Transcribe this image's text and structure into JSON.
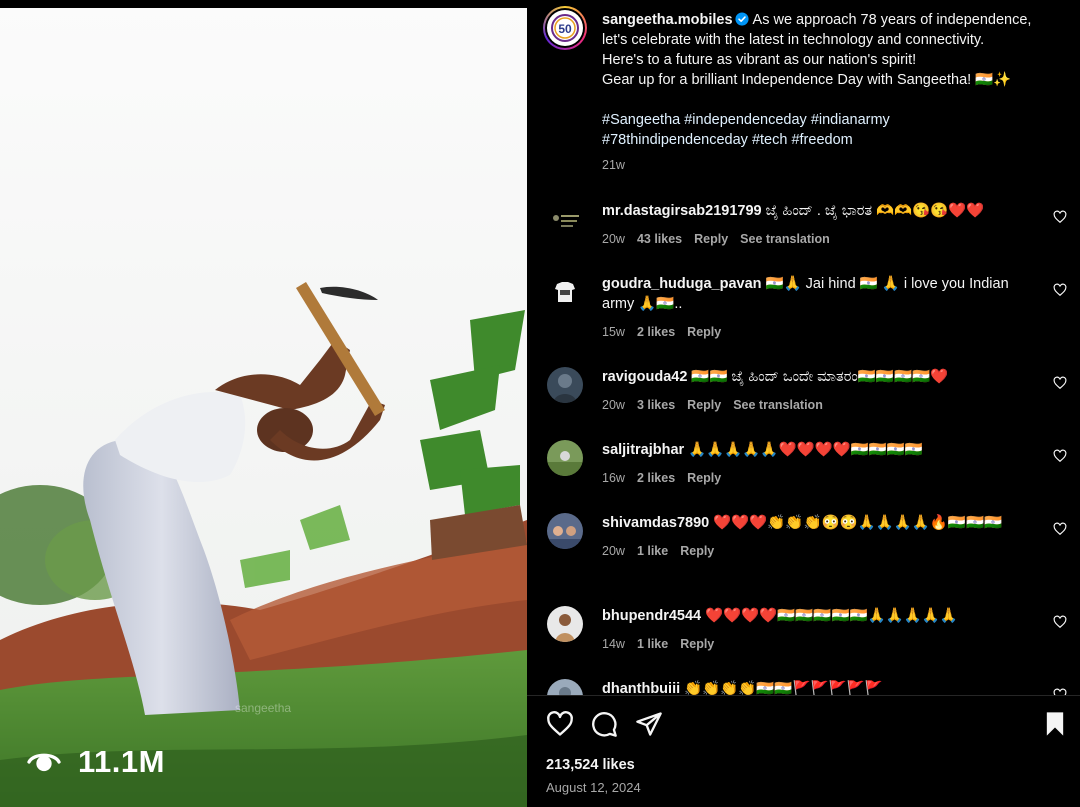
{
  "media": {
    "view_count": "11.1M",
    "watermark": "sangeetha"
  },
  "post": {
    "username": "sangeetha.mobiles",
    "logo_text": "50",
    "caption_lines": [
      "As we approach 78 years of independence,",
      "let's celebrate with the latest in technology and connectivity.",
      "Here's to a future as vibrant as our nation's spirit!",
      "Gear up for a brilliant Independence Day with Sangeetha! 🇮🇳✨"
    ],
    "hashtags_line1": "#Sangeetha #independenceday #indianarmy",
    "hashtags_line2": "#78thindipendenceday #tech #freedom",
    "time": "21w"
  },
  "comments": [
    {
      "user": "mr.dastagirsab2191799",
      "text": "ಜೈ ಹಿಂದ್ . ಜೈ ಭಾರತ 🫶🫶😘😘❤️❤️",
      "time": "20w",
      "likes": "43 likes",
      "reply": "Reply",
      "translate": "See translation"
    },
    {
      "user": "goudra_huduga_pavan",
      "text": "🇮🇳🙏 Jai hind 🇮🇳 🙏 i love you Indian army 🙏🇮🇳..",
      "time": "15w",
      "likes": "2 likes",
      "reply": "Reply",
      "translate": ""
    },
    {
      "user": "ravigouda42",
      "text": "🇮🇳🇮🇳 ಜೈ ಹಿಂದ್ ಒಂದೇ ಮಾತರಂ🇮🇳🇮🇳🇮🇳🇮🇳❤️",
      "time": "20w",
      "likes": "3 likes",
      "reply": "Reply",
      "translate": "See translation"
    },
    {
      "user": "saljitrajbhar",
      "text": "🙏🙏🙏🙏🙏❤️❤️❤️❤️🇮🇳🇮🇳🇮🇳🇮🇳",
      "time": "16w",
      "likes": "2 likes",
      "reply": "Reply",
      "translate": ""
    },
    {
      "user": "shivamdas7890",
      "text": "❤️❤️❤️👏👏👏😳😳🙏🙏🙏🙏🔥🇮🇳🇮🇳🇮🇳",
      "time": "20w",
      "likes": "1 like",
      "reply": "Reply",
      "translate": ""
    },
    {
      "user": "bhupendr4544",
      "text": "❤️❤️❤️❤️🇮🇳🇮🇳🇮🇳🇮🇳🇮🇳🙏🙏🙏🙏🙏",
      "time": "14w",
      "likes": "1 like",
      "reply": "Reply",
      "translate": ""
    },
    {
      "user": "dhanthbuiii",
      "text": "👏👏👏👏🇮🇳🇮🇳🚩🚩🚩🚩🚩",
      "time": "",
      "likes": "",
      "reply": "",
      "translate": ""
    }
  ],
  "actions": {
    "likes": "213,524 likes",
    "date": "August 12, 2024"
  },
  "icons": [
    "view-eye-icon",
    "heart-icon",
    "comment-icon",
    "share-icon",
    "bookmark-icon",
    "verified-badge-icon"
  ],
  "colors": {
    "background": "#000000",
    "text": "#f5f5f5",
    "muted": "#a8a8a8",
    "verified": "#0095f6",
    "hashtag": "#e0f1ff"
  }
}
